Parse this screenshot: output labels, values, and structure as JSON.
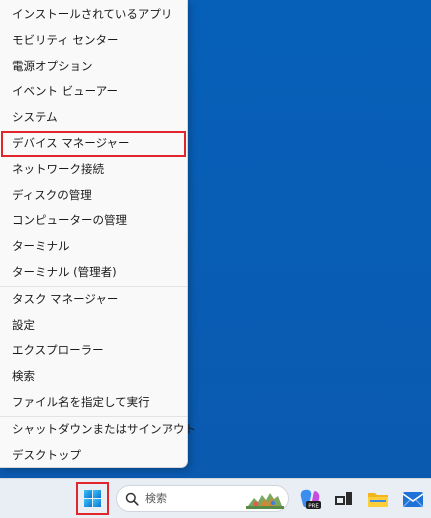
{
  "menu": {
    "items": [
      {
        "label": "インストールされているアプリ"
      },
      {
        "label": "モビリティ センター"
      },
      {
        "label": "電源オプション"
      },
      {
        "label": "イベント ビューアー"
      },
      {
        "label": "システム"
      },
      {
        "label": "デバイス マネージャー",
        "highlighted": true
      },
      {
        "label": "ネットワーク接続"
      },
      {
        "label": "ディスクの管理"
      },
      {
        "label": "コンピューターの管理"
      },
      {
        "label": "ターミナル"
      },
      {
        "label": "ターミナル (管理者)"
      },
      {
        "label": "タスク マネージャー"
      },
      {
        "label": "設定"
      },
      {
        "label": "エクスプローラー"
      },
      {
        "label": "検索"
      },
      {
        "label": "ファイル名を指定して実行"
      },
      {
        "label": "シャットダウンまたはサインアウト",
        "submenu_indicator": "›"
      },
      {
        "label": "デスクトップ"
      }
    ]
  },
  "taskbar": {
    "search_placeholder": "検索",
    "icons": [
      "windows-start-icon",
      "search-icon",
      "copilot-icon",
      "task-view-icon",
      "file-explorer-icon",
      "mail-icon"
    ]
  },
  "colors": {
    "desktop": "#0a5fb4",
    "highlight_border": "#e0262c",
    "menu_bg": "#f9f9f9",
    "taskbar_bg": "#e8eef4"
  }
}
